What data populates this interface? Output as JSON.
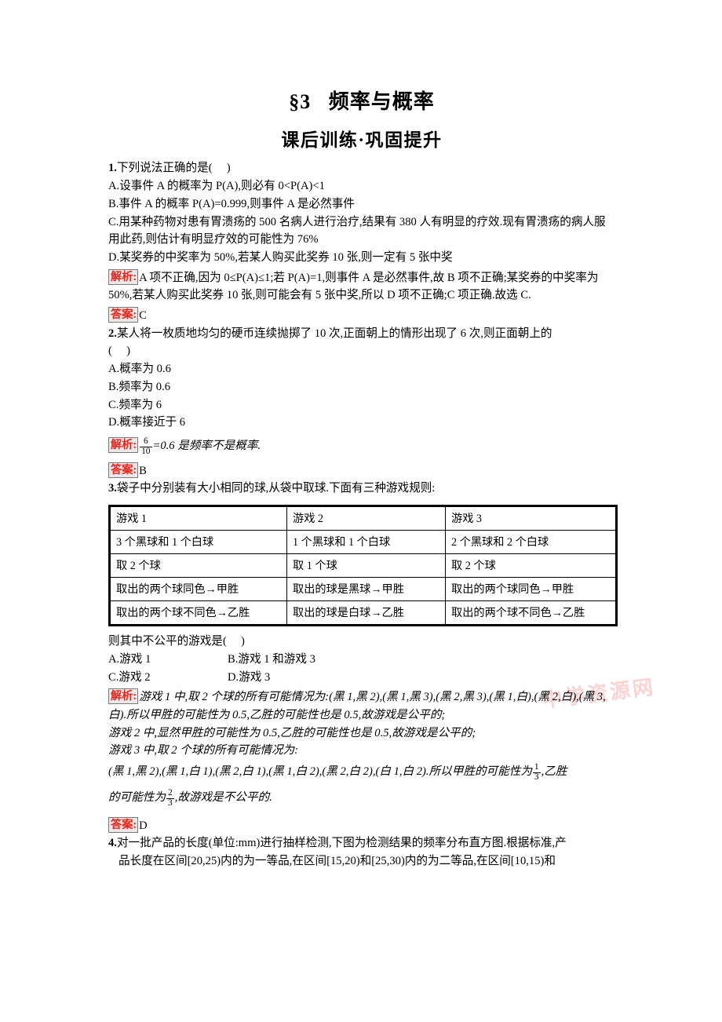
{
  "header": {
    "section_label": "§3",
    "title": "频率与概率",
    "subtitle": "课后训练·巩固提升"
  },
  "labels": {
    "analysis": "解析:",
    "answer": "答案:"
  },
  "watermark": "中学资源网",
  "questions": [
    {
      "number": "1.",
      "stem": "下列说法正确的是(     )",
      "options": [
        "A.设事件 A 的概率为 P(A),则必有 0<P(A)<1",
        "B.事件 A 的概率 P(A)=0.999,则事件 A 是必然事件",
        "C.用某种药物对患有胃溃疡的 500 名病人进行治疗,结果有 380 人有明显的疗效.现有胃溃疡的病人服用此药,则估计有明显疗效的可能性为 76%",
        "D.某奖券的中奖率为 50%,若某人购买此奖券 10 张,则一定有 5 张中奖"
      ],
      "analysis": "A 项不正确,因为 0≤P(A)≤1;若 P(A)=1,则事件 A 是必然事件,故 B 项不正确;某奖券的中奖率为 50%,若某人购买此奖券 10 张,则可能会有 5 张中奖,所以 D 项不正确;C 项正确.故选 C.",
      "answer": "C"
    },
    {
      "number": "2.",
      "stem": "某人将一枚质地均匀的硬币连续抛掷了 10 次,正面朝上的情形出现了 6 次,则正面朝上的",
      "stem_line2": "(     )",
      "options": [
        "A.概率为 0.6",
        "B.频率为 0.6",
        "C.频率为 6",
        "D.概率接近于 6"
      ],
      "analysis_frac": {
        "num": "6",
        "den": "10"
      },
      "analysis_tail": "=0.6 是频率不是概率.",
      "answer": "B"
    },
    {
      "number": "3.",
      "stem": "袋子中分别装有大小相同的球,从袋中取球.下面有三种游戏规则:",
      "table": {
        "headers": [
          "游戏 1",
          "游戏 2",
          "游戏 3"
        ],
        "rows": [
          [
            "3 个黑球和 1 个白球",
            "1 个黑球和 1 个白球",
            "2 个黑球和 2 个白球"
          ],
          [
            "取 2 个球",
            "取 1 个球",
            "取 2 个球"
          ],
          [
            "取出的两个球同色→甲胜",
            "取出的球是黑球→甲胜",
            "取出的两个球同色→甲胜"
          ],
          [
            "取出的两个球不同色→乙胜",
            "取出的球是白球→乙胜",
            "取出的两个球不同色→乙胜"
          ]
        ]
      },
      "prompt": "则其中不公平的游戏是(     )",
      "option_rows": [
        {
          "left": "A.游戏 1",
          "right": "B.游戏 1 和游戏 3"
        },
        {
          "left": "C.游戏 2",
          "right": "D.游戏 3"
        }
      ],
      "analysis_p1": "游戏 1 中,取 2 个球的所有可能情况为:(黑 1,黑 2),(黑 1,黑 3),(黑 2,黑 3),(黑 1,白),(黑 2,白),(黑 3,白).所以甲胜的可能性为 0.5,乙胜的可能性也是 0.5,故游戏是公平的;",
      "analysis_p2": "游戏 2 中,显然甲胜的可能性为 0.5,乙胜的可能性也是 0.5,故游戏是公平的;",
      "analysis_p3": "游戏 3 中,取 2 个球的所有可能情况为:",
      "analysis_p4_pre": "(黑 1,黑 2),(黑 1,白 1),(黑 2,白 1),(黑 1,白 2),(黑 2,白 2),(白 1,白 2).所以甲胜的可能性为",
      "analysis_p4_frac": {
        "num": "1",
        "den": "3"
      },
      "analysis_p4_mid": ",乙胜",
      "analysis_p5_pre": "的可能性为",
      "analysis_p5_frac": {
        "num": "2",
        "den": "3"
      },
      "analysis_p5_tail": ",故游戏是不公平的.",
      "answer": "D"
    },
    {
      "number": "4.",
      "stem_line1": "对一批产品的长度(单位:mm)进行抽样检测,下图为检测结果的频率分布直方图.根据标准,产",
      "stem_line2": "品长度在区间[20,25)内的为一等品,在区间[15,20)和[25,30)内的为二等品,在区间[10,15)和"
    }
  ]
}
